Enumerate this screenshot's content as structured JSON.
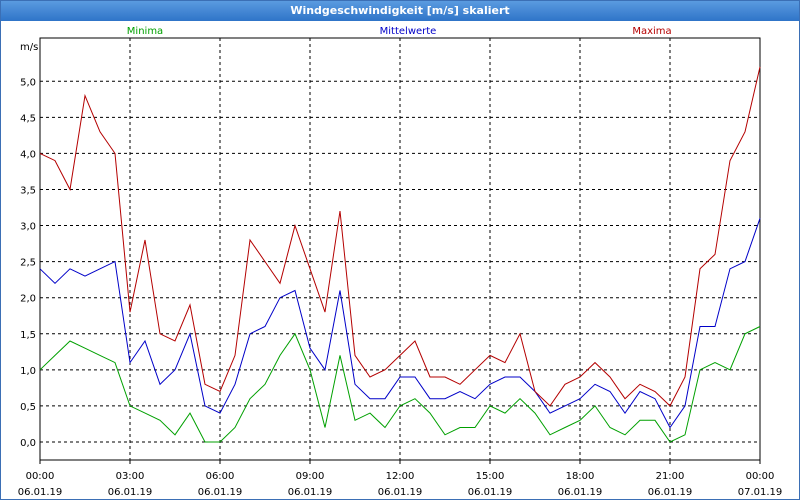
{
  "window": {
    "title": "Windgeschwindigkeit [m/s] skaliert"
  },
  "chart_data": {
    "type": "line",
    "title": "Windgeschwindigkeit [m/s] skaliert",
    "ylabel": "m/s",
    "ylim": [
      -0.25,
      5.6
    ],
    "xlim": [
      0,
      24
    ],
    "grid": true,
    "legend_placement": "top",
    "y_ticks": [
      "0,0",
      "0,5",
      "1,0",
      "1,5",
      "2,0",
      "2,5",
      "3,0",
      "3,5",
      "4,0",
      "4,5",
      "5,0"
    ],
    "x_ticks": [
      {
        "time": "00:00",
        "date": "06.01.19"
      },
      {
        "time": "03:00",
        "date": "06.01.19"
      },
      {
        "time": "06:00",
        "date": "06.01.19"
      },
      {
        "time": "09:00",
        "date": "06.01.19"
      },
      {
        "time": "12:00",
        "date": "06.01.19"
      },
      {
        "time": "15:00",
        "date": "06.01.19"
      },
      {
        "time": "18:00",
        "date": "06.01.19"
      },
      {
        "time": "21:00",
        "date": "06.01.19"
      },
      {
        "time": "00:00",
        "date": "07.01.19"
      }
    ],
    "series": [
      {
        "name": "Minima",
        "color": "#00a000",
        "x": [
          0,
          0.5,
          1,
          1.5,
          2,
          2.5,
          3,
          3.5,
          4,
          4.5,
          5,
          5.5,
          6,
          6.5,
          7,
          7.5,
          8,
          8.5,
          9,
          9.5,
          10,
          10.5,
          11,
          11.5,
          12,
          12.5,
          13,
          13.5,
          14,
          14.5,
          15,
          15.5,
          16,
          16.5,
          17,
          17.5,
          18,
          18.5,
          19,
          19.5,
          20,
          20.5,
          21,
          21.5,
          22,
          22.5,
          23,
          23.5,
          24
        ],
        "values": [
          1.0,
          1.2,
          1.4,
          1.3,
          1.2,
          1.1,
          0.5,
          0.4,
          0.3,
          0.1,
          0.4,
          0.0,
          0.0,
          0.2,
          0.6,
          0.8,
          1.2,
          1.5,
          1.0,
          0.2,
          1.2,
          0.3,
          0.4,
          0.2,
          0.5,
          0.6,
          0.4,
          0.1,
          0.2,
          0.2,
          0.5,
          0.4,
          0.6,
          0.4,
          0.1,
          0.2,
          0.3,
          0.5,
          0.2,
          0.1,
          0.3,
          0.3,
          0.0,
          0.1,
          1.0,
          1.1,
          1.0,
          1.5,
          1.6
        ]
      },
      {
        "name": "Mittelwerte",
        "color": "#0000c8",
        "x": [
          0,
          0.5,
          1,
          1.5,
          2,
          2.5,
          3,
          3.5,
          4,
          4.5,
          5,
          5.5,
          6,
          6.5,
          7,
          7.5,
          8,
          8.5,
          9,
          9.5,
          10,
          10.5,
          11,
          11.5,
          12,
          12.5,
          13,
          13.5,
          14,
          14.5,
          15,
          15.5,
          16,
          16.5,
          17,
          17.5,
          18,
          18.5,
          19,
          19.5,
          20,
          20.5,
          21,
          21.5,
          22,
          22.5,
          23,
          23.5,
          24
        ],
        "values": [
          2.4,
          2.2,
          2.4,
          2.3,
          2.4,
          2.5,
          1.1,
          1.4,
          0.8,
          1.0,
          1.5,
          0.5,
          0.4,
          0.8,
          1.5,
          1.6,
          2.0,
          2.1,
          1.3,
          1.0,
          2.1,
          0.8,
          0.6,
          0.6,
          0.9,
          0.9,
          0.6,
          0.6,
          0.7,
          0.6,
          0.8,
          0.9,
          0.9,
          0.7,
          0.4,
          0.5,
          0.6,
          0.8,
          0.7,
          0.4,
          0.7,
          0.6,
          0.2,
          0.5,
          1.6,
          1.6,
          2.4,
          2.5,
          3.1
        ]
      },
      {
        "name": "Maxima",
        "color": "#b40000",
        "x": [
          0,
          0.5,
          1,
          1.5,
          2,
          2.5,
          3,
          3.5,
          4,
          4.5,
          5,
          5.5,
          6,
          6.5,
          7,
          7.5,
          8,
          8.5,
          9,
          9.5,
          10,
          10.5,
          11,
          11.5,
          12,
          12.5,
          13,
          13.5,
          14,
          14.5,
          15,
          15.5,
          16,
          16.5,
          17,
          17.5,
          18,
          18.5,
          19,
          19.5,
          20,
          20.5,
          21,
          21.5,
          22,
          22.5,
          23,
          23.5,
          24
        ],
        "values": [
          4.0,
          3.9,
          3.5,
          4.8,
          4.3,
          4.0,
          1.8,
          2.8,
          1.5,
          1.4,
          1.9,
          0.8,
          0.7,
          1.2,
          2.8,
          2.5,
          2.2,
          3.0,
          2.4,
          1.8,
          3.2,
          1.2,
          0.9,
          1.0,
          1.2,
          1.4,
          0.9,
          0.9,
          0.8,
          1.0,
          1.2,
          1.1,
          1.5,
          0.7,
          0.5,
          0.8,
          0.9,
          1.1,
          0.9,
          0.6,
          0.8,
          0.7,
          0.5,
          0.9,
          2.4,
          2.6,
          3.9,
          4.3,
          5.2
        ]
      }
    ]
  }
}
